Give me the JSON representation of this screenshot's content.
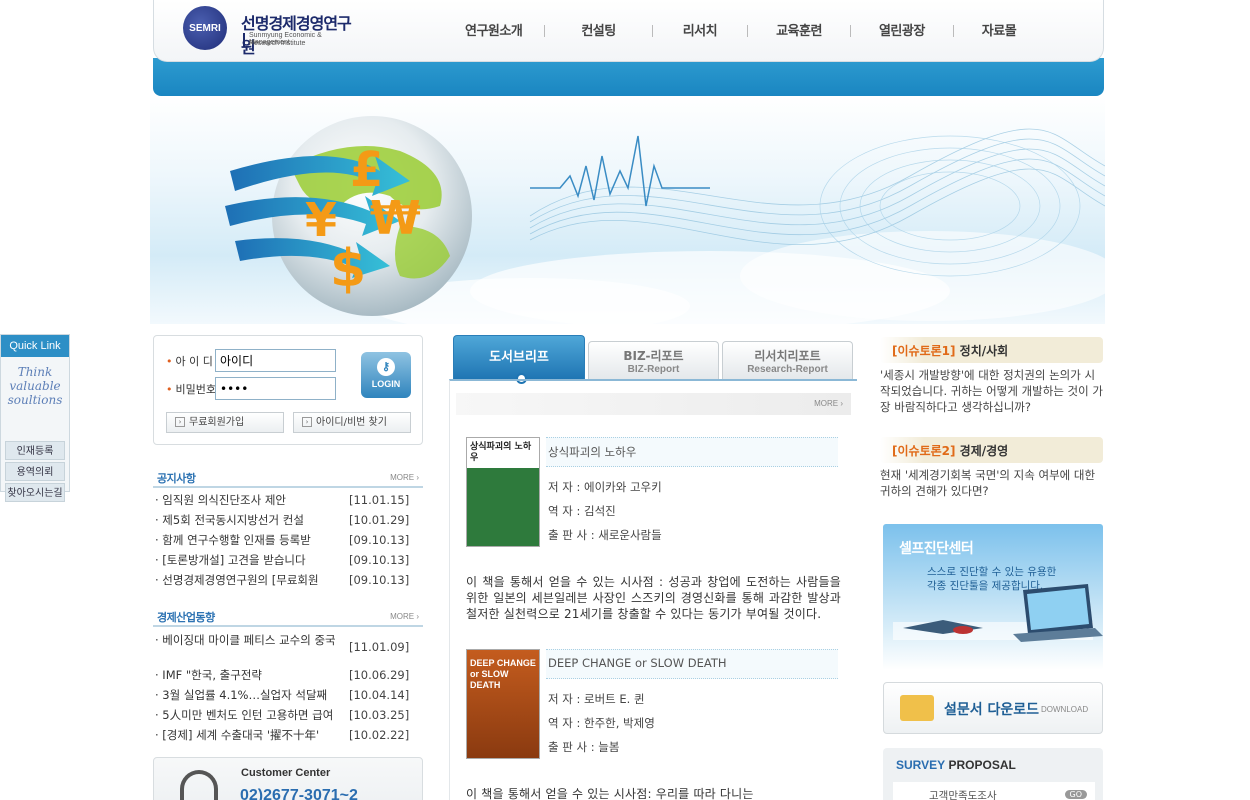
{
  "header": {
    "logo_emblem": "SEMRI",
    "logo_name": "선명경제경영연구원",
    "logo_en_1": "Sunmyung Economic & Management",
    "logo_en_2": "Research Institute",
    "nav": [
      "연구원소개",
      "컨설팅",
      "리서치",
      "교육훈련",
      "열린광장",
      "자료몰"
    ]
  },
  "hero": {
    "currency_symbols": [
      "£",
      "¥",
      "₩",
      "$"
    ]
  },
  "quick": {
    "title": "Quick Link",
    "slogan": [
      "Think",
      "valuable",
      "soultions"
    ],
    "links": [
      "인재등록",
      "용역의뢰",
      "찾아오시는길"
    ]
  },
  "login": {
    "id_label": "아 이 디",
    "pw_label": "비밀번호",
    "id_value": "아이디",
    "pw_value": "••••",
    "login_button": "LOGIN",
    "join_button": "무료회원가입",
    "find_button": "아이디/비번 찾기"
  },
  "notice": {
    "title": "공지사항",
    "more": "MORE",
    "items": [
      {
        "title": "· 임직원 의식진단조사 제안",
        "date": "[11.01.15]"
      },
      {
        "title": "·  제5회 전국동시지방선거 컨설",
        "date": "[10.01.29]"
      },
      {
        "title": "· 함께 연구수행할 인재를 등록받",
        "date": "[09.10.13]"
      },
      {
        "title": "· [토론방개설] 고견을 받습니다",
        "date": "[09.10.13]"
      },
      {
        "title": "· 선명경제경영연구원의 [무료회원",
        "date": "[09.10.13]"
      }
    ]
  },
  "economy": {
    "title": "경제산업동향",
    "more": "MORE",
    "items": [
      {
        "title": "· 베이징대 마이클 페티스 교수의 중국",
        "date": "[11.01.09]"
      },
      {
        "title": "·  IMF \"한국, 출구전략",
        "date": "[10.06.29]"
      },
      {
        "title": "· 3월 실업률 4.1%…실업자 석달째",
        "date": "[10.04.14]"
      },
      {
        "title": "· 5人미만 벤처도 인턴 고용하면 급여",
        "date": "[10.03.25]"
      },
      {
        "title": "· [경제] 세계 수출대국 '擢不十年'",
        "date": "[10.02.22]"
      }
    ]
  },
  "customer": {
    "title": "Customer Center",
    "phone": "02)2677-3071~2"
  },
  "tabs": [
    {
      "label": "도서브리프",
      "sub": ""
    },
    {
      "label": "BIZ-리포트",
      "sub": "BIZ-Report"
    },
    {
      "label": "리서치리포트",
      "sub": "Research-Report"
    }
  ],
  "center": {
    "more": "MORE",
    "books": [
      {
        "cover_text": "상식파괴의 노하우",
        "title": "상식파괴의 노하우",
        "author": "저 자 : 에이카와 고우키",
        "translator": "역 자 : 김석진",
        "publisher": "출 판 사 : 새로운사람들",
        "desc": "이 책을 통해서 얻을 수 있는 시사점 : 성공과 창업에 도전하는 사람들을 위한 일본의 세븐일레븐 사장인 스즈키의 경영신화를 통해 과감한 발상과 철저한 실천력으로 21세기를 창출할 수 있다는 동기가 부여될 것이다."
      },
      {
        "cover_text": "DEEP CHANGE or SLOW DEATH",
        "title": "DEEP CHANGE or SLOW DEATH",
        "author": "저 자 : 로버트 E. 퀸",
        "translator": "역 자 : 한주한, 박제영",
        "publisher": "출 판 사 : 늘봄",
        "desc": "이 책을 통해서 얻을 수 있는 시사점: 우리를 따라 다니는"
      }
    ]
  },
  "issues": [
    {
      "tag": "[이슈토론1]",
      "topic": "정치/사회",
      "body": "'세종시 개발방향'에 대한 정치권의 논의가 시작되었습니다. 귀하는 어떻게 개발하는 것이 가장 바람직하다고 생각하십니까?"
    },
    {
      "tag": "[이슈토론2]",
      "topic": "경제/경영",
      "body": "현재 '세계경기회복 국면'의 지속 여부에 대한 귀하의 견해가 있다면?"
    }
  ],
  "selfdiag": {
    "title": "셀프진단센터",
    "line1": "스스로 진단할 수 있는 유용한",
    "line2": "각종 진단툴을 제공합니다."
  },
  "survey_download": {
    "title": "설문서 다운로드",
    "sub": "DOWNLOAD"
  },
  "survey_proposal": {
    "title_a": "SURVEY",
    "title_b": " PROPOSAL",
    "item": "고객만족도조사",
    "go": "GO"
  }
}
